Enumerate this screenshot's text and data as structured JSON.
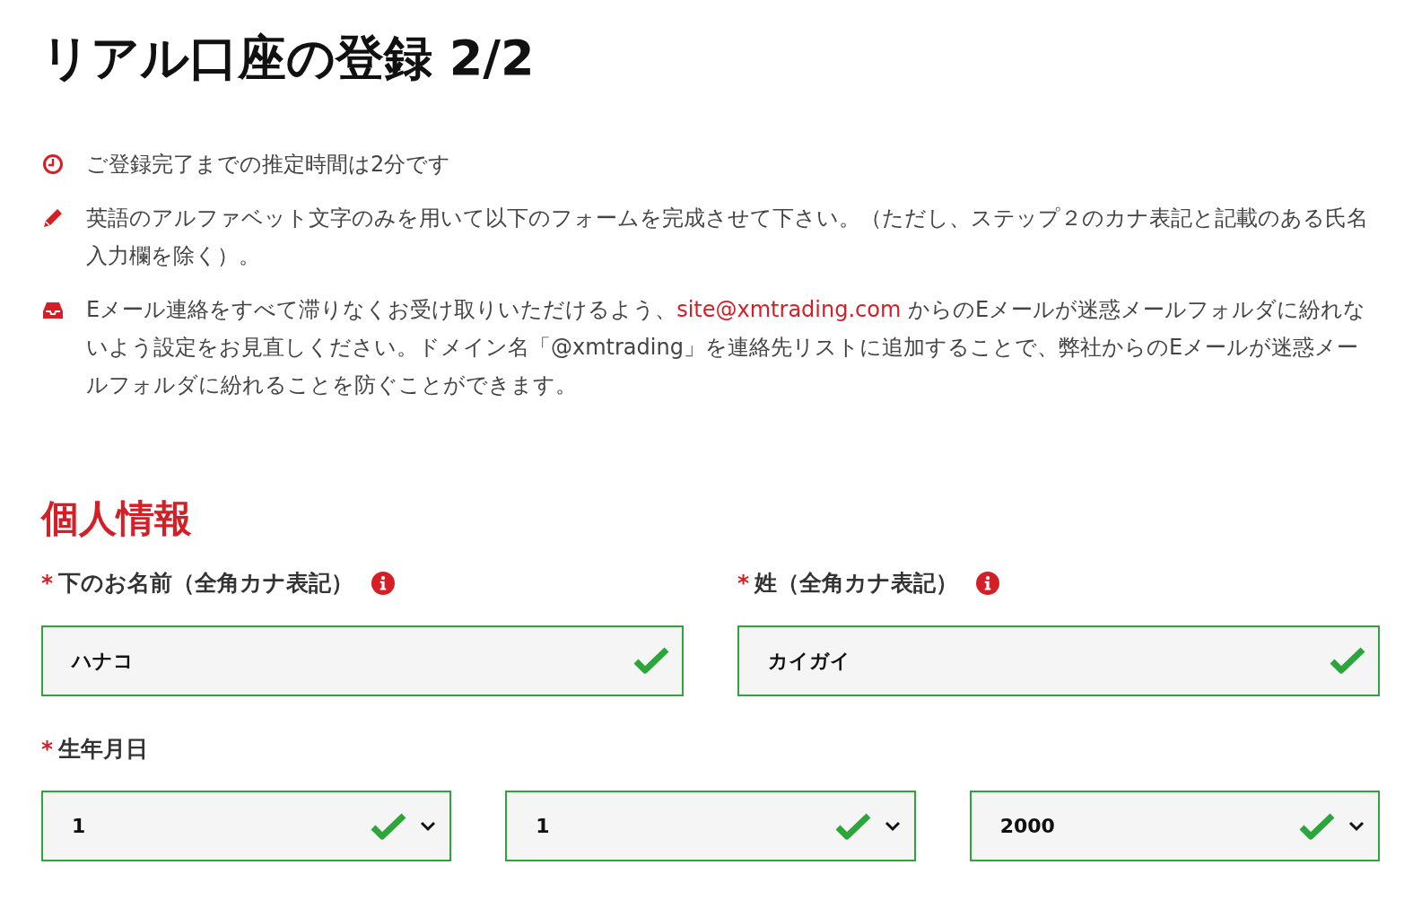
{
  "title": "リアル口座の登録 2/2",
  "notices": [
    {
      "kind": "clock",
      "text": "ご登録完了までの推定時間は2分です"
    },
    {
      "kind": "pencil",
      "text": "英語のアルファベット文字のみを用いて以下のフォームを完成させて下さい。（ただし、ステップ２のカナ表記と記載のある氏名入力欄を除く）。"
    },
    {
      "kind": "inbox",
      "text": "Eメール連絡をすべて滞りなくお受け取りいただけるよう、",
      "link": "site@xmtrading.com",
      "after": " からのEメールが迷惑メールフォルダに紛れないよう設定をお見直しください。ドメイン名「@xmtrading」を連絡先リストに追加することで、弊社からのEメールが迷惑メールフォルダに紛れることを防ぐことができます。"
    }
  ],
  "section_title": "個人情報",
  "name_fields": [
    {
      "required_mark": "*",
      "label": "下のお名前（全角カナ表記）",
      "info": true,
      "value": "ハナコ",
      "valid": true
    },
    {
      "required_mark": "*",
      "label": "姓（全角カナ表記）",
      "info": true,
      "value": "カイガイ",
      "valid": true
    }
  ],
  "birth_date": {
    "required_mark": "*",
    "label": "生年月日",
    "selects": [
      {
        "value": "1",
        "valid": true
      },
      {
        "value": "1",
        "valid": true
      },
      {
        "value": "2000",
        "valid": true
      }
    ]
  }
}
